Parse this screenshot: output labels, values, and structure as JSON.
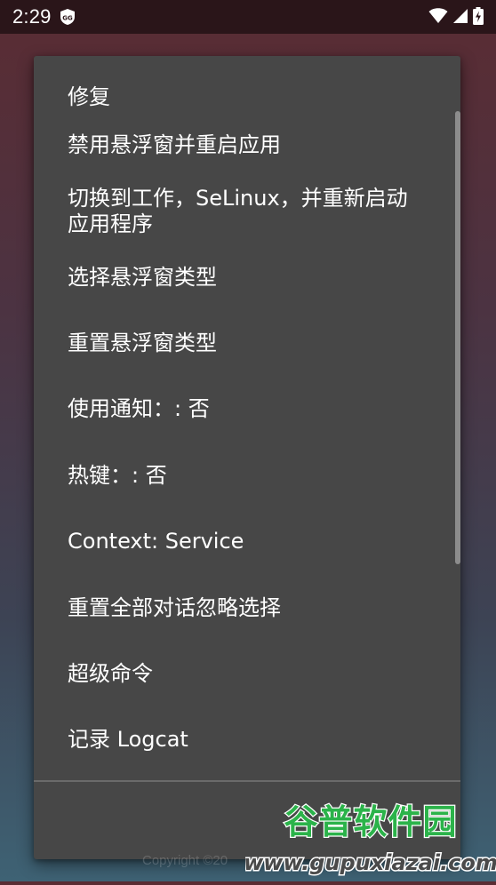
{
  "status_bar": {
    "time": "2:29"
  },
  "menu": {
    "items": [
      {
        "label": "修复"
      },
      {
        "label": "禁用悬浮窗并重启应用"
      },
      {
        "label": "切换到工作，SeLinux，并重新启动应用程序"
      },
      {
        "label": "选择悬浮窗类型"
      },
      {
        "label": "重置悬浮窗类型"
      },
      {
        "label": "使用通知：: 否"
      },
      {
        "label": "热键：: 否"
      },
      {
        "label": "Context: Service"
      },
      {
        "label": "重置全部对话忽略选择"
      },
      {
        "label": "超级命令"
      },
      {
        "label": "记录 Logcat"
      }
    ]
  },
  "background": {
    "copyright": "Copyright ©20"
  },
  "watermark": {
    "title": "谷普软件园",
    "url": "www.gupuxiazai.com"
  },
  "colors": {
    "menu_bg": "#474747",
    "status_bar_bg": "#2a1519",
    "watermark_green": "#2bb34a"
  },
  "icons": {
    "status_app": "game-guardian-icon",
    "wifi": "wifi-icon",
    "signal": "signal-icon",
    "battery": "battery-charging-icon"
  }
}
